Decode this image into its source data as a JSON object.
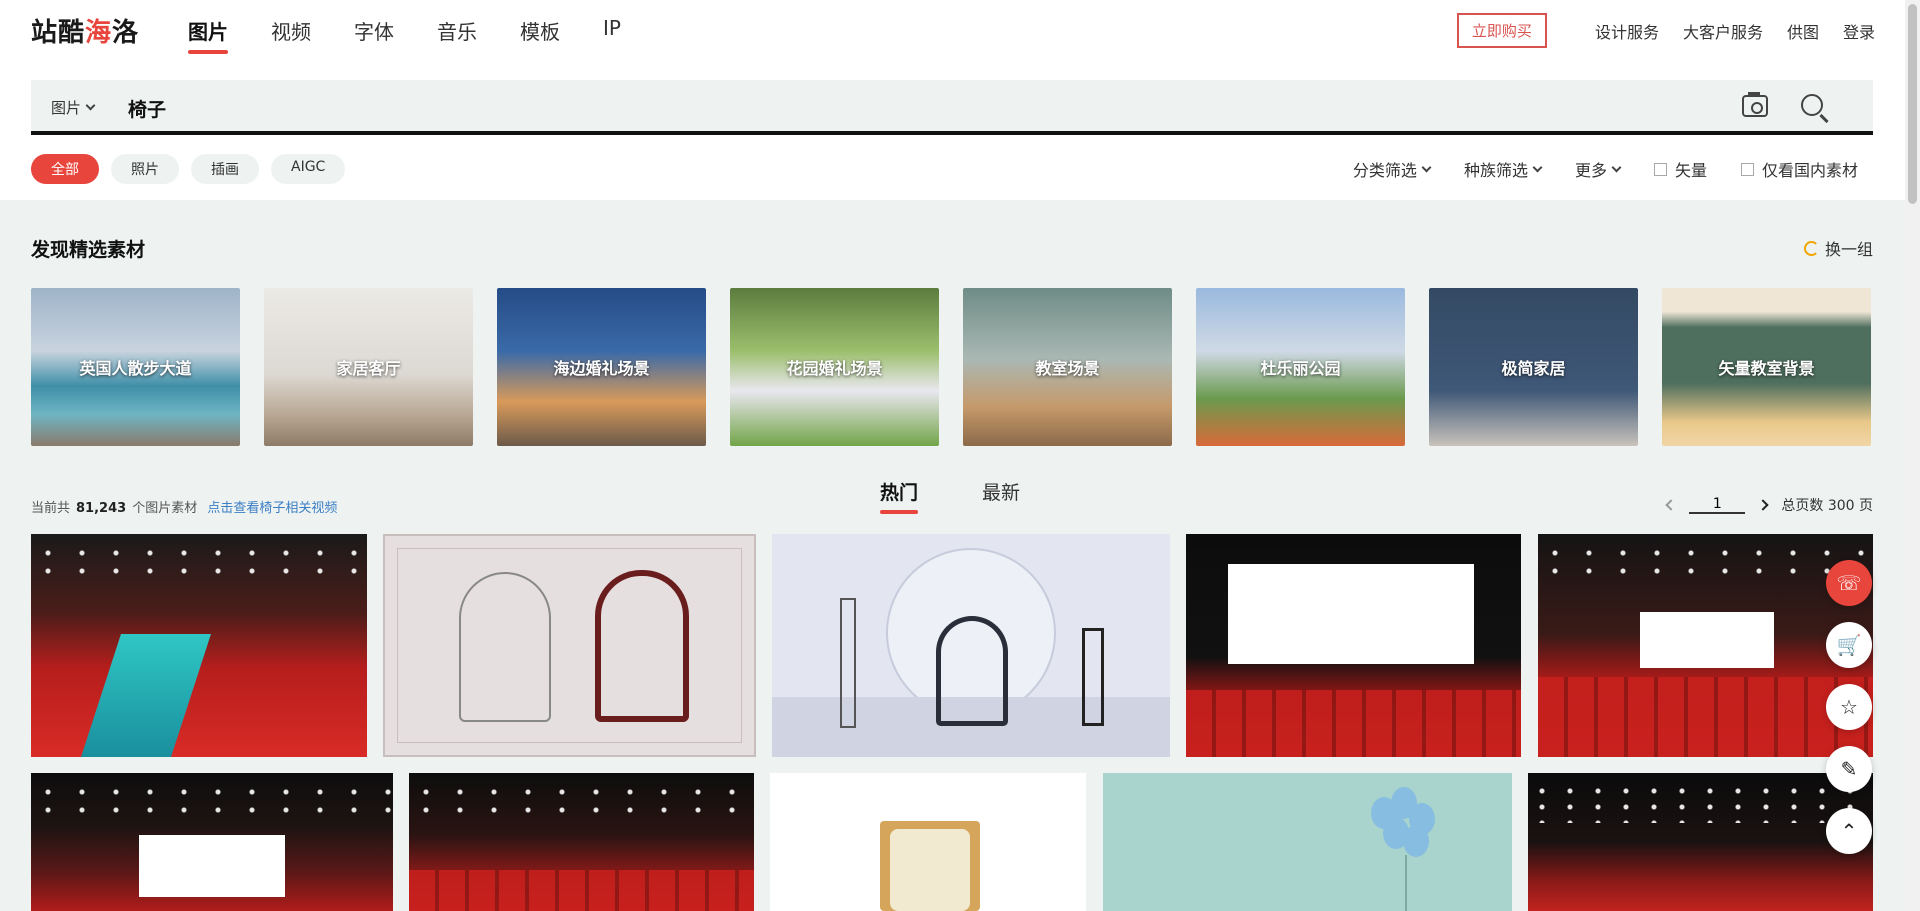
{
  "header": {
    "logo_text_1": "站酷",
    "logo_text_2": "海",
    "logo_text_3": "洛",
    "nav": [
      "图片",
      "视频",
      "字体",
      "音乐",
      "模板",
      "IP"
    ],
    "buy_label": "立即购买",
    "links": [
      "设计服务",
      "大客户服务",
      "供图",
      "登录"
    ]
  },
  "search": {
    "category": "图片",
    "query": "椅子"
  },
  "filters": {
    "chips": [
      "全部",
      "照片",
      "插画",
      "AIGC"
    ],
    "dropdowns": [
      "分类筛选",
      "种族筛选",
      "更多"
    ],
    "checkboxes": [
      "矢量",
      "仅看国内素材"
    ]
  },
  "discover": {
    "title": "发现精选素材",
    "refresh_label": "换一组",
    "cards": [
      "英国人散步大道",
      "家居客厅",
      "海边婚礼场景",
      "花园婚礼场景",
      "教室场景",
      "杜乐丽公园",
      "极简家居",
      "矢量教室背景"
    ]
  },
  "results": {
    "prefix": "当前共",
    "count": "81,243",
    "suffix": "个图片素材",
    "video_link": "点击查看椅子相关视频",
    "tabs": [
      "热门",
      "最新"
    ],
    "page_value": "1",
    "total_pages": "总页数 300 页"
  },
  "colors": {
    "accent": "#e8453c",
    "link": "#3b7ec4"
  },
  "floaters": [
    "headset-icon",
    "cart-icon",
    "star-icon",
    "edit-icon",
    "chevron-up-icon"
  ]
}
